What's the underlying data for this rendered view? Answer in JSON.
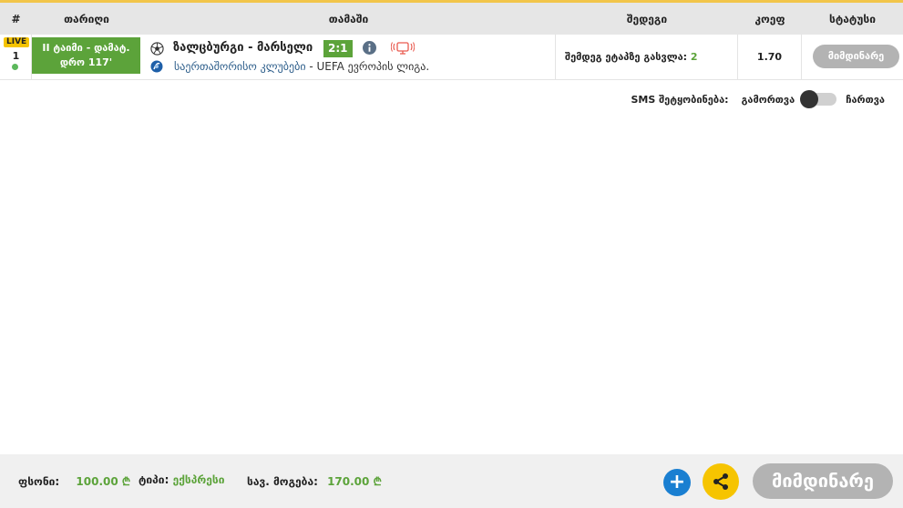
{
  "header": {
    "num": "#",
    "date": "თარიღი",
    "game": "თამაში",
    "result": "შედეგი",
    "coef": "კოეფ",
    "status": "სტატუსი"
  },
  "bet_row": {
    "live": "LIVE",
    "num": "1",
    "date_line1": "II ტაიმი - დამატ.",
    "date_line2": "დრო 117'",
    "teams": "ზალცბურგი - მარსელი",
    "score": "2:1",
    "league_blue": "საერთაშორისო კლუბები",
    "league_rest": " - UEFA ევროპის ლიგა.",
    "result_label": "შემდეგ ეტაპზე გასვლა:",
    "result_value": " 2",
    "coef": "1.70",
    "status": "მიმდინარე"
  },
  "sms": {
    "label": "SMS შეტყობინება:",
    "off": "გამორთვა",
    "on": "ჩართვა"
  },
  "footer": {
    "stake_label": "ფსონი:",
    "stake_value": "100.00",
    "type_label": "ტიპი:",
    "type_value": "ექსპრესი",
    "win_label": "სავ. მოგება:",
    "win_value": "170.00",
    "currency": "₾",
    "add": "+",
    "status": "მიმდინარე"
  },
  "colors": {
    "accent_green": "#5ca33a",
    "live_yellow": "#f6c400",
    "status_gray": "#b3b3b3",
    "add_blue": "#1a7fd1"
  }
}
